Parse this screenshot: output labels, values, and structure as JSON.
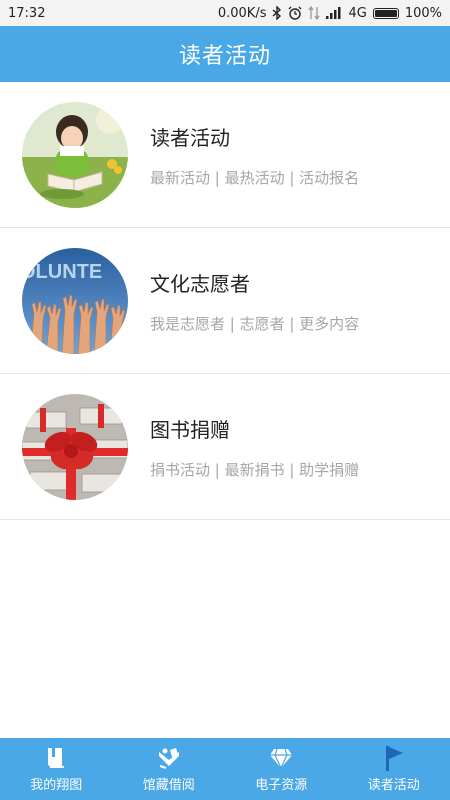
{
  "status_bar": {
    "time": "17:32",
    "speed": "0.00K/s",
    "network": "4G",
    "battery": "100%"
  },
  "header": {
    "title": "读者活动"
  },
  "items": [
    {
      "title": "读者活动",
      "subtitle": "最新活动 | 最热活动 | 活动报名",
      "image": "child-reading-book-photo"
    },
    {
      "title": "文化志愿者",
      "subtitle": "我是志愿者 | 志愿者 | 更多内容",
      "image": "volunteer-raised-hands-photo",
      "image_text": "OLUNTE"
    },
    {
      "title": "图书捐赠",
      "subtitle": "捐书活动 | 最新捐书 | 助学捐赠",
      "image": "gift-wrapped-books-photo"
    }
  ],
  "tabs": [
    {
      "label": "我的翔图",
      "icon": "book-icon"
    },
    {
      "label": "馆藏借阅",
      "icon": "reading-person-icon"
    },
    {
      "label": "电子资源",
      "icon": "diamond-icon"
    },
    {
      "label": "读者活动",
      "icon": "flag-icon",
      "active": true
    }
  ],
  "colors": {
    "primary": "#4aa8e6",
    "divider": "#e6e6e6",
    "subtitle": "#a6a6a6"
  }
}
